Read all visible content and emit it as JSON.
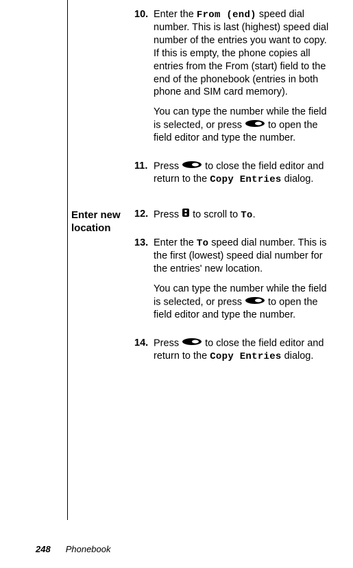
{
  "section1": {
    "label": "",
    "step10": {
      "num": "10.",
      "para1_a": "Enter the ",
      "para1_mono": "From (end)",
      "para1_b": " speed dial number. This is last (highest) speed dial number of the entries you want to copy. If this is empty, the phone copies all entries from the From (start) field to the end of the phonebook (entries in both phone and SIM card memory).",
      "para2_a": "You can type the number while the field is selected, or press ",
      "para2_b": " to open the field editor and type the number."
    },
    "step11": {
      "num": "11.",
      "para1_a": "Press ",
      "para1_b": " to close the field editor and return to the ",
      "para1_mono": "Copy Entries",
      "para1_c": " dialog."
    }
  },
  "section2": {
    "label": "Enter new location",
    "step12": {
      "num": "12.",
      "para1_a": "Press ",
      "para1_b": " to scroll to ",
      "para1_mono": "To",
      "para1_c": "."
    },
    "step13": {
      "num": "13.",
      "para1_a": "Enter the ",
      "para1_mono": "To",
      "para1_b": " speed dial number. This is the first (lowest) speed dial number for the entries' new location.",
      "para2_a": "You can type the number while the field is selected, or press ",
      "para2_b": " to open the field editor and type the number."
    },
    "step14": {
      "num": "14.",
      "para1_a": "Press ",
      "para1_b": " to close the field editor and return to the ",
      "para1_mono": "Copy Entries",
      "para1_c": " dialog."
    }
  },
  "footer": {
    "page": "248",
    "section": "Phonebook"
  }
}
